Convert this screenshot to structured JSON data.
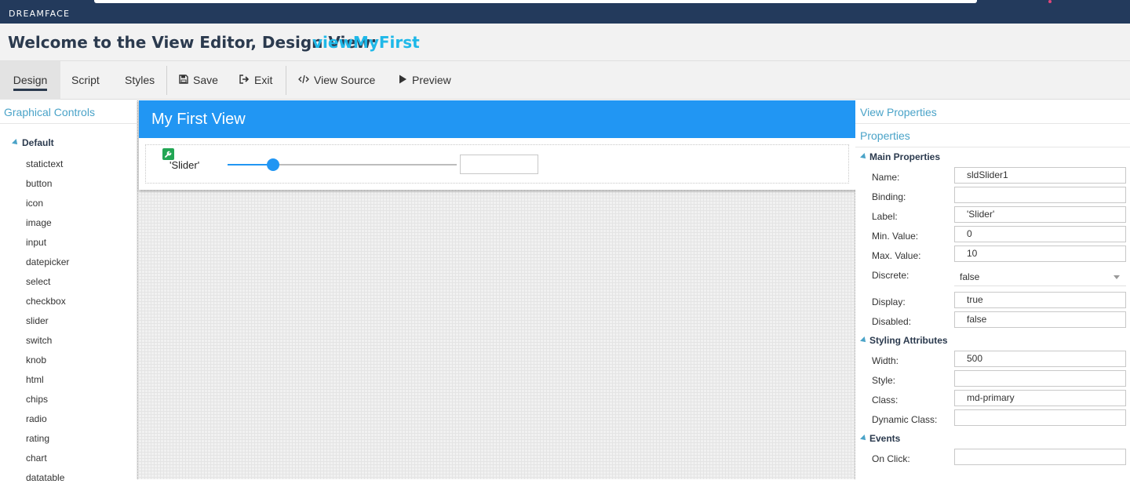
{
  "brand": {
    "logo_text": "DREAMFACE"
  },
  "header": {
    "title": "Welcome to the View Editor, Design View:",
    "view_name": "viewMyFirst"
  },
  "toolbar": {
    "design": "Design",
    "script": "Script",
    "styles": "Styles",
    "save": "Save",
    "exit": "Exit",
    "view_source": "View Source",
    "preview": "Preview",
    "active_tab": "Design"
  },
  "left_panel": {
    "header": "Graphical Controls",
    "group": "Default",
    "items": [
      "statictext",
      "button",
      "icon",
      "image",
      "input",
      "datepicker",
      "select",
      "checkbox",
      "slider",
      "switch",
      "knob",
      "html",
      "chips",
      "radio",
      "rating",
      "chart",
      "datatable"
    ]
  },
  "canvas": {
    "view_title": "My First View",
    "slider": {
      "label": "'Slider'",
      "value": 2,
      "min": 0,
      "max": 10,
      "input_value": ""
    }
  },
  "right_panel": {
    "view_properties": "View Properties",
    "properties": "Properties",
    "main_section": "Main Properties",
    "name_label": "Name:",
    "name_value": "sldSlider1",
    "binding_label": "Binding:",
    "binding_value": "",
    "label_label": "Label:",
    "label_value": "'Slider'",
    "min_label": "Min. Value:",
    "min_value": "0",
    "max_label": "Max. Value:",
    "max_value": "10",
    "discrete_label": "Discrete:",
    "discrete_value": "false",
    "display_label": "Display:",
    "display_value": "true",
    "disabled_label": "Disabled:",
    "disabled_value": "false",
    "styling_section": "Styling Attributes",
    "width_label": "Width:",
    "width_value": "500",
    "style_label": "Style:",
    "style_value": "",
    "class_label": "Class:",
    "class_value": "md-primary",
    "dynclass_label": "Dynamic Class:",
    "dynclass_value": "",
    "events_section": "Events",
    "onclick_label": "On Click:",
    "onclick_value": ""
  },
  "colors": {
    "brand_bar": "#233a5c",
    "accent_blue": "#2196f3",
    "view_name": "#1fb8e8",
    "panel_header": "#4aa3c8",
    "wrench_badge": "#22a654"
  }
}
